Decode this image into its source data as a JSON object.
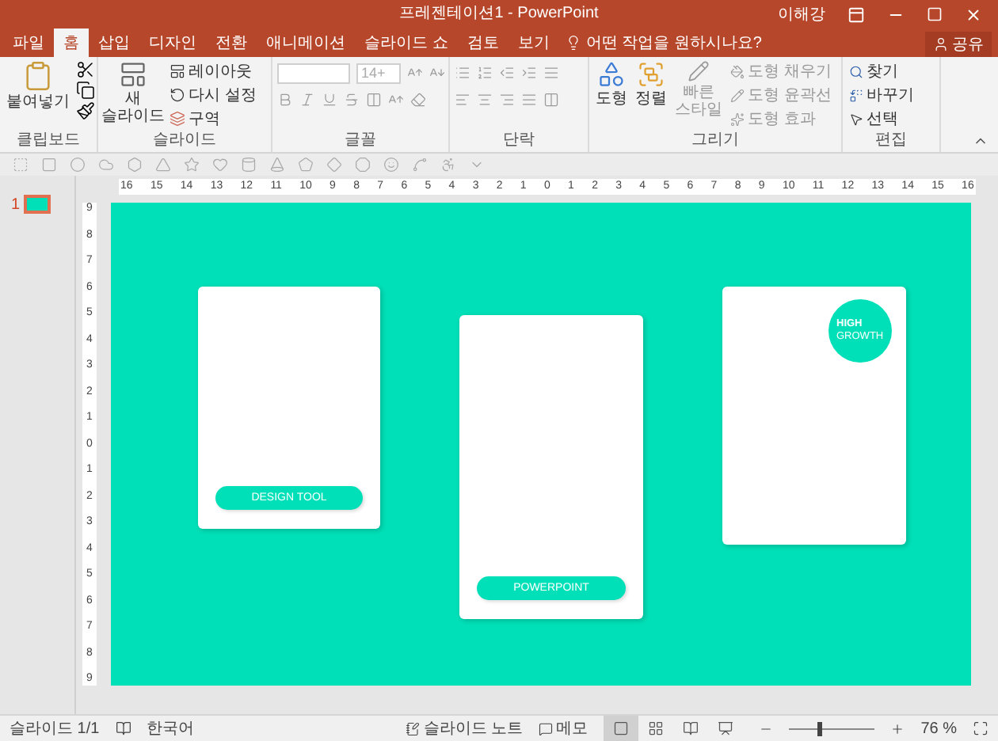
{
  "window": {
    "title": "프레젠테이션1 - PowerPoint",
    "user": "이해강"
  },
  "tabs": [
    {
      "label": "파일",
      "selected": false
    },
    {
      "label": "홈",
      "selected": true
    },
    {
      "label": "삽입",
      "selected": false
    },
    {
      "label": "디자인",
      "selected": false
    },
    {
      "label": "전환",
      "selected": false
    },
    {
      "label": "애니메이션",
      "selected": false
    },
    {
      "label": "슬라이드 쇼",
      "selected": false
    },
    {
      "label": "검토",
      "selected": false
    },
    {
      "label": "보기",
      "selected": false
    }
  ],
  "tell_me": {
    "placeholder": "어떤 작업을 원하시나요?"
  },
  "share_button": "공유",
  "ribbon": {
    "clipboard": {
      "label": "클립보드",
      "paste": "붙여넣기"
    },
    "slides": {
      "label": "슬라이드",
      "new_slide": "새 슬라이드",
      "layout": "레이아웃",
      "reset": "다시 설정",
      "section": "구역"
    },
    "font": {
      "label": "글꼴",
      "font_size": "14+"
    },
    "paragraph": {
      "label": "단락"
    },
    "drawing": {
      "label": "그리기",
      "shapes": "도형",
      "arrange": "정렬",
      "quick_styles": "빠른 스타일",
      "shape_fill": "도형 채우기",
      "shape_outline": "도형 윤곽선",
      "shape_effects": "도형 효과"
    },
    "editing": {
      "label": "편집",
      "find": "찾기",
      "replace": "바꾸기",
      "select": "선택"
    }
  },
  "thumbnails": [
    {
      "number": "1",
      "selected": true
    }
  ],
  "ruler": {
    "horizontal": [
      "16",
      "15",
      "14",
      "13",
      "12",
      "11",
      "10",
      "9",
      "8",
      "7",
      "6",
      "5",
      "4",
      "3",
      "2",
      "1",
      "0",
      "1",
      "2",
      "3",
      "4",
      "5",
      "6",
      "7",
      "8",
      "9",
      "10",
      "11",
      "12",
      "13",
      "14",
      "15",
      "16"
    ],
    "vertical": [
      "9",
      "8",
      "7",
      "6",
      "5",
      "4",
      "3",
      "2",
      "1",
      "0",
      "1",
      "2",
      "3",
      "4",
      "5",
      "6",
      "7",
      "8",
      "9"
    ]
  },
  "slide": {
    "cards": [
      {
        "kind": "button",
        "button": "DESIGN TOOL"
      },
      {
        "kind": "button",
        "button": "POWERPOINT"
      },
      {
        "kind": "badge",
        "badge_title": "HIGH",
        "badge_subtitle": "GROWTH"
      }
    ]
  },
  "status_bar": {
    "slide_counter": "슬라이드 1/1",
    "language": "한국어",
    "notes": "슬라이드 노트",
    "comments": "메모",
    "views": [
      {
        "selected": true
      },
      {
        "selected": false
      },
      {
        "selected": false
      },
      {
        "selected": false
      }
    ],
    "zoom": {
      "level": 0.35,
      "reading": "76 %"
    }
  }
}
